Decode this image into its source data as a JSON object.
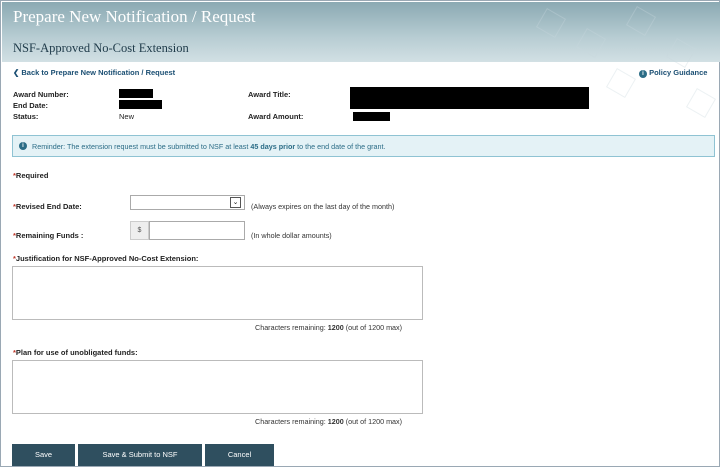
{
  "header": {
    "title": "Prepare New Notification / Request",
    "subtitle": "NSF-Approved No-Cost Extension"
  },
  "nav": {
    "back_arrow": "❮",
    "back_label": "Back to Prepare New Notification / Request",
    "policy_label": "Policy Guidance"
  },
  "award": {
    "number_label": "Award Number:",
    "end_date_label": "End Date:",
    "status_label": "Status:",
    "status_value": "New",
    "title_label": "Award Title:",
    "amount_label": "Award Amount:"
  },
  "reminder": {
    "icon": "info-icon",
    "prefix": "Reminder: The extension request must be submitted to NSF at least ",
    "emphasis": "45 days prior",
    "suffix": " to the end date of the grant."
  },
  "form": {
    "required_mark": "*",
    "required_label": "Required",
    "revised_end_date_label": "Revised End Date:",
    "revised_end_date_value": "",
    "revised_end_date_hint": "(Always expires on the last day of the month)",
    "remaining_funds_label": "Remaining Funds :",
    "currency_symbol": "$",
    "remaining_funds_value": "",
    "remaining_funds_hint": "(In whole dollar amounts)",
    "justification_label": "Justification for NSF-Approved No-Cost Extension:",
    "justification_counter_prefix": "Characters remaining: ",
    "justification_remaining": "1200",
    "justification_counter_suffix": " (out of 1200 max)",
    "plan_label": "Plan for use of unobligated funds:",
    "plan_counter_prefix": "Characters remaining: ",
    "plan_remaining": "1200",
    "plan_counter_suffix": " (out of 1200 max)"
  },
  "buttons": {
    "save": "Save",
    "save_submit": "Save & Submit to NSF",
    "cancel": "Cancel"
  },
  "colors": {
    "header_gradient_top": "#8ba9b3",
    "link": "#1b4f73",
    "reminder_bg": "#e4f2f6",
    "button_bg": "#2f4f5f"
  }
}
